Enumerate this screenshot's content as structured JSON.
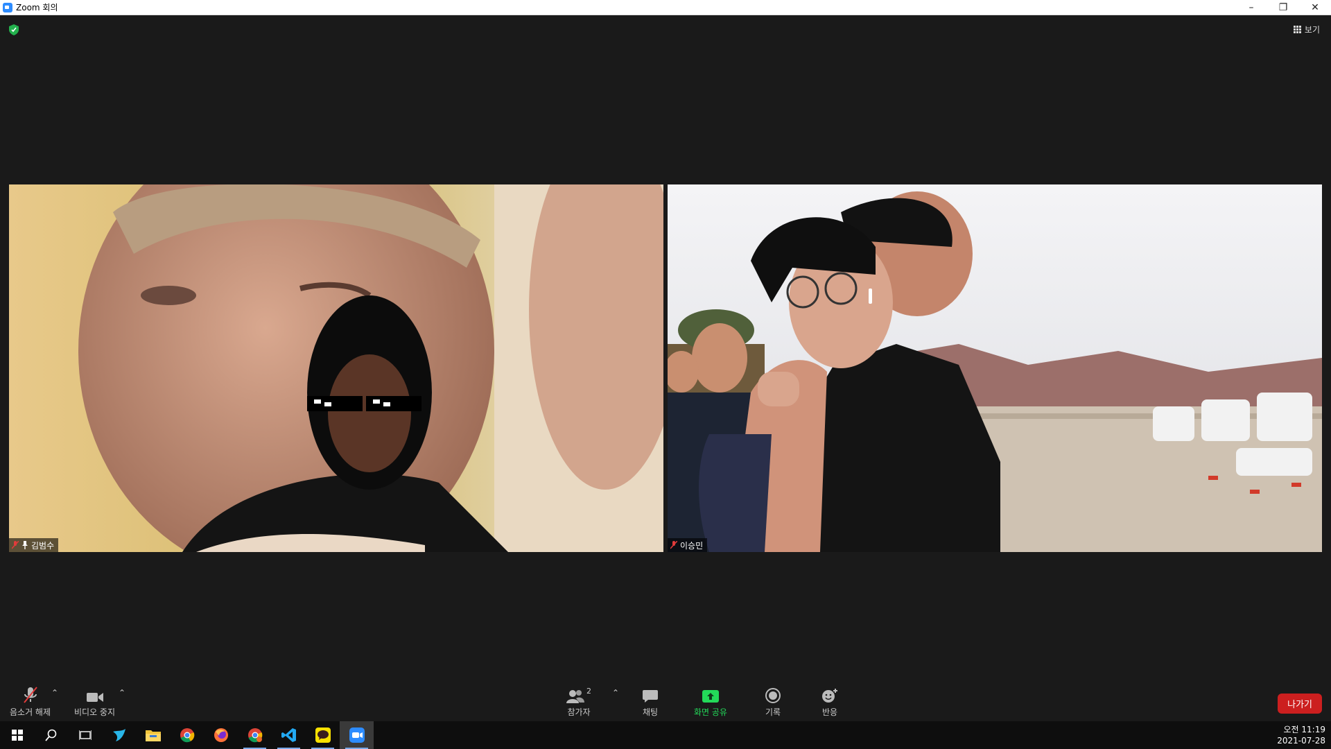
{
  "window": {
    "title": "Zoom 회의"
  },
  "meeting": {
    "view_label": "보기",
    "tiles": [
      {
        "name": "김범수"
      },
      {
        "name": "이승민"
      }
    ]
  },
  "toolbar": {
    "mute_label": "음소거 해제",
    "video_label": "비디오 중지",
    "participants_label": "참가자",
    "participants_count": "2",
    "chat_label": "채팅",
    "share_label": "화면 공유",
    "record_label": "기록",
    "reactions_label": "반응",
    "leave_label": "나가기"
  },
  "taskbar": {
    "items": [
      "windows-start",
      "search",
      "task-view",
      "app-bird",
      "file-explorer",
      "chrome",
      "firefox",
      "chrome-profile",
      "vscode",
      "kakaotalk",
      "zoom"
    ],
    "time": "오전 11:19",
    "date": "2021-07-28"
  },
  "colors": {
    "background": "#1a1a1a",
    "accent": "#2d8cff",
    "share_green": "#23d959",
    "leave_red": "#cc1f1f"
  }
}
